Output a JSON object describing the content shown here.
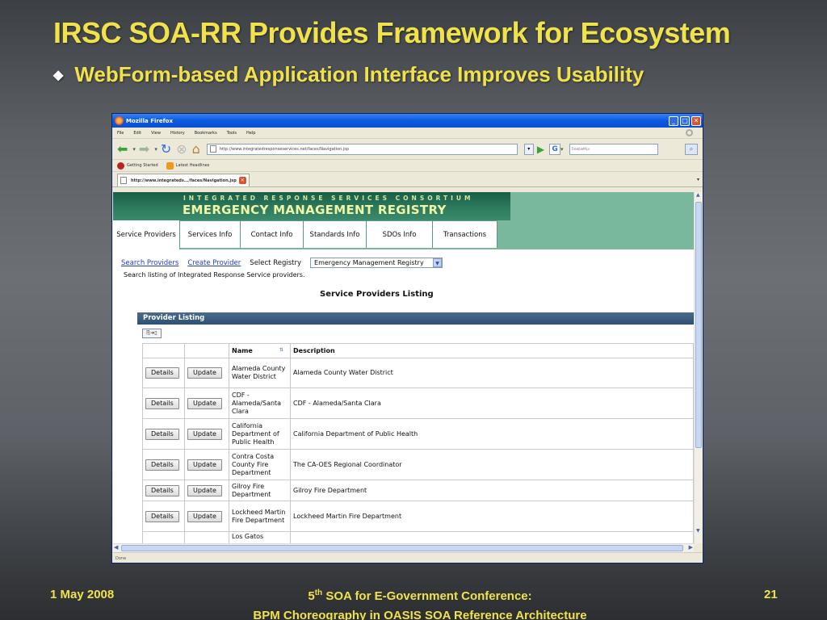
{
  "slide": {
    "title": "IRSC SOA-RR Provides Framework for Ecosystem",
    "bullet": "WebForm-based Application Interface Improves Usability",
    "footer_date": "1 May 2008",
    "footer_conf_num": "5",
    "footer_conf_sup": "th",
    "footer_conf_rest": " SOA for E-Government Conference:",
    "footer_line2": "BPM Choreography in OASIS SOA Reference Architecture",
    "page_number": "21"
  },
  "browser": {
    "title": "Mozilla Firefox",
    "menu": [
      "File",
      "Edit",
      "View",
      "History",
      "Bookmarks",
      "Tools",
      "Help"
    ],
    "url": "http://www.integratedresponseservices.net/faces/Navigation.jsp",
    "search_placeholder": "FreebieMLv",
    "bookmarks": [
      "Getting Started",
      "Latest Headlines"
    ],
    "tab_title": "http://www.integrateds.../faces/Navigation.jsp",
    "status": "Done"
  },
  "app": {
    "banner_sub": "INTEGRATED RESPONSE SERVICES CONSORTIUM",
    "banner_main": "EMERGENCY MANAGEMENT REGISTRY",
    "tabs": [
      "Service Providers",
      "Services Info",
      "Contact Info",
      "Standards Info",
      "SDOs Info",
      "Transactions"
    ],
    "links": {
      "search": "Search Providers",
      "create": "Create Provider",
      "select_label": "Select Registry"
    },
    "registry_value": "Emergency Management Registry",
    "description": "Search listing of Integrated Response Service providers.",
    "listing_title": "Service Providers Listing",
    "panel_title": "Provider Listing",
    "export_label": "⎘➔▯",
    "columns": {
      "name": "Name",
      "description": "Description"
    },
    "buttons": {
      "details": "Details",
      "update": "Update"
    },
    "rows": [
      {
        "name": "Alameda County Water District",
        "description": "Alameda County Water District"
      },
      {
        "name": "CDF - Alameda/Santa Clara",
        "description": "CDF - Alameda/Santa Clara"
      },
      {
        "name": "California Department of Public Health",
        "description": "California Department of Public Health"
      },
      {
        "name": "Contra Costa County Fire Department",
        "description": "The CA-OES Regional Coordinator"
      },
      {
        "name": "Gilroy Fire Department",
        "description": "Gilroy Fire Department"
      },
      {
        "name": "Lockheed Martin Fire Department",
        "description": "Lockheed Martin Fire Department"
      },
      {
        "name": "Los Gatos",
        "description": ""
      }
    ]
  }
}
